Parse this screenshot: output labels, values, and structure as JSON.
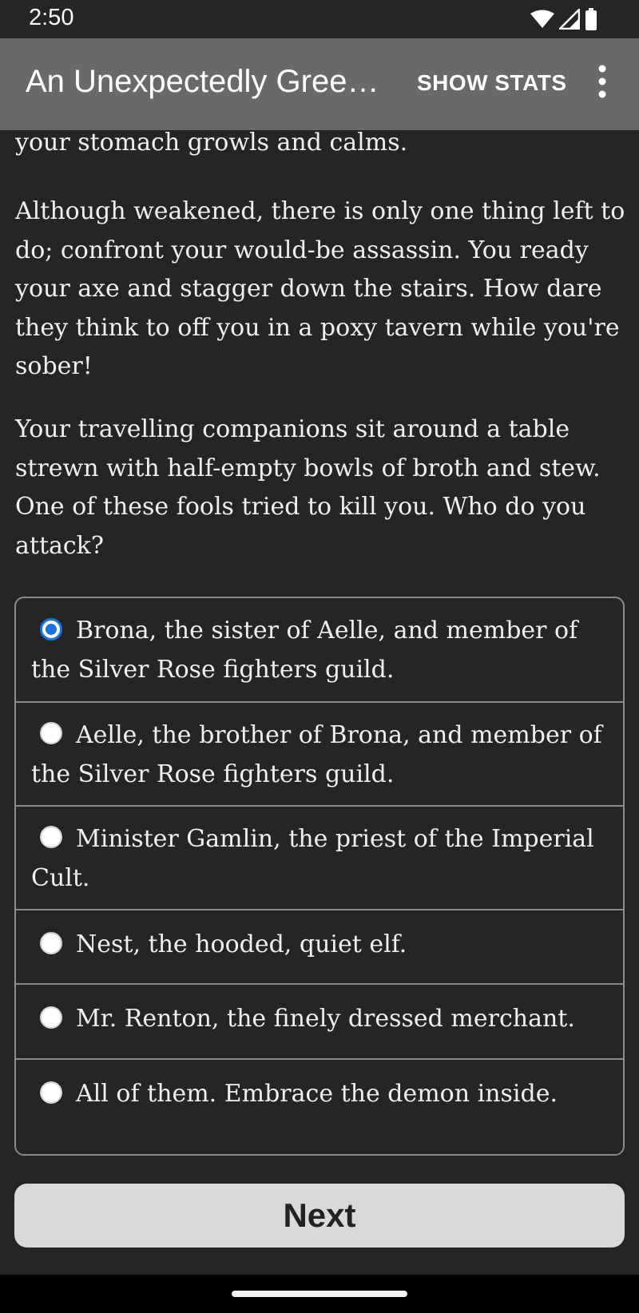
{
  "status_bar": {
    "time": "2:50",
    "icons": [
      "wifi-icon",
      "cell-signal-icon",
      "battery-icon"
    ]
  },
  "app_bar": {
    "title": "An Unexpectedly Green…",
    "show_stats_label": "SHOW STATS",
    "overflow_icon": "more-vert-icon"
  },
  "story": {
    "paragraphs": [
      "your stomach growls and calms.",
      "Although weakened, there is only one thing left to do; confront your would-be assassin. You ready your axe and stagger down the stairs. How dare they think to off you in a poxy tavern while you're sober!",
      "Your travelling companions sit around a table strewn with half-empty bowls of broth and stew. One of these fools tried to kill you. Who do you attack?"
    ]
  },
  "choices": [
    {
      "label": "Brona, the sister of Aelle, and member of the Silver Rose fighters guild.",
      "selected": true
    },
    {
      "label": "Aelle, the brother of Brona, and member of the Silver Rose fighters guild.",
      "selected": false
    },
    {
      "label": "Minister Gamlin, the priest of the Imperial Cult.",
      "selected": false
    },
    {
      "label": "Nest, the hooded, quiet elf.",
      "selected": false
    },
    {
      "label": "Mr. Renton, the finely dressed merchant.",
      "selected": false
    },
    {
      "label": "All of them. Embrace the demon inside.",
      "selected": false
    }
  ],
  "next_button": {
    "label": "Next"
  },
  "colors": {
    "background": "#252525",
    "app_bar": "#696969",
    "accent": "#1a73e8",
    "button": "#d9d9d9"
  }
}
